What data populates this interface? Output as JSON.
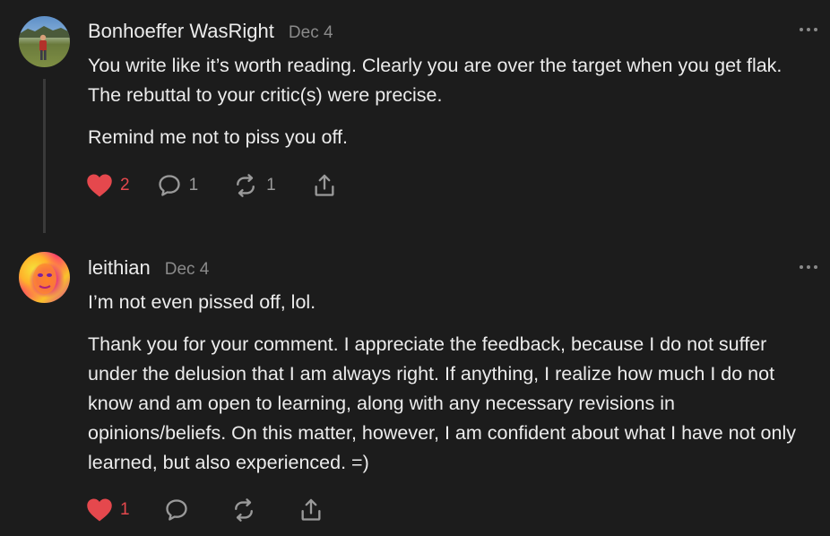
{
  "comments": [
    {
      "author": "Bonhoeffer WasRight",
      "date": "Dec 4",
      "paragraphs": [
        "You write like it’s worth reading. Clearly you are over the target when you get flak. The rebuttal to your critic(s) were precise.",
        "Remind me not to piss you off."
      ],
      "likes": "2",
      "replies": "1",
      "restacks": "1",
      "liked": true
    },
    {
      "author": "leithian",
      "date": "Dec 4",
      "paragraphs": [
        "I’m not even pissed off, lol.",
        "Thank you for your comment. I appreciate the feedback, because I do not suffer under the delusion that I am always right. If anything, I realize how much I do not know and am open to learning, along with any necessary revisions in opinions/beliefs. On this matter, however, I am confident about what I have not only learned, but also experienced. =)"
      ],
      "likes": "1",
      "replies": "",
      "restacks": "",
      "liked": true
    }
  ],
  "icons": {
    "like": "heart-icon",
    "reply": "speech-bubble-icon",
    "restack": "restack-icon",
    "share": "share-icon",
    "more": "more-dots-icon"
  },
  "colors": {
    "background": "#1c1c1c",
    "text": "#ececec",
    "muted": "#8a8a8a",
    "like_red": "#e5484d"
  }
}
